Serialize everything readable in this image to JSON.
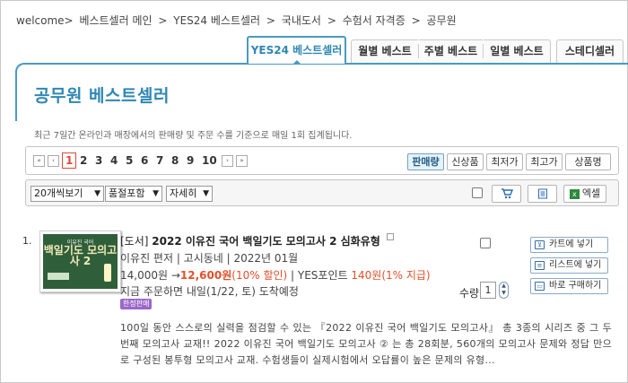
{
  "breadcrumb": [
    "welcome>",
    "베스트셀러 메인",
    ">",
    "YES24 베스트셀러",
    ">",
    "국내도서",
    ">",
    "수험서 자격증",
    ">",
    "공무원"
  ],
  "tabs": [
    {
      "label": "YES24 베스트셀러",
      "active": true
    },
    {
      "label": "월별 베스트",
      "active": false
    },
    {
      "label": "주별 베스트",
      "active": false
    },
    {
      "label": "일별 베스트",
      "active": false
    },
    {
      "label": "스테디셀러",
      "active": false
    }
  ],
  "page_title": "공무원 베스트셀러",
  "description": "최근 7일간 온라인과 매장에서의 판매량 및 주문 수를 기준으로 매일 1회 집계됩니다.",
  "pagination": {
    "first_icon": "double-left-arrow",
    "prev_icon": "left-arrow",
    "pages": [
      "1",
      "2",
      "3",
      "4",
      "5",
      "6",
      "7",
      "8",
      "9",
      "10"
    ],
    "current": "1",
    "next_icon": "right-arrow",
    "last_icon": "double-right-arrow"
  },
  "sort_options": [
    {
      "label": "판매량",
      "active": true
    },
    {
      "label": "신상품",
      "active": false
    },
    {
      "label": "최저가",
      "active": false
    },
    {
      "label": "최고가",
      "active": false
    },
    {
      "label": "상품명",
      "active": false
    }
  ],
  "view_controls": {
    "per_page": "20개씩보기",
    "stock": "품절포함",
    "detail": "자세히",
    "excel_label": "엑셀"
  },
  "product": {
    "rank": "1.",
    "category": "[도서]",
    "title": "2022 이유진 국어 백일기도 모의고사 2 심화유형",
    "author_line": "이유진 편저 | 고시동네 | 2022년 01월",
    "price_original": "14,000원",
    "price_arrow": "→",
    "price_sale": "12,600원",
    "discount": "(10% 할인)",
    "points_prefix": " | YES포인트 ",
    "points": "140원",
    "points_rate": "(1% 지급)",
    "delivery": "지금 주문하면 내일(1/22, 토) 도착예정",
    "badge": "한정판매",
    "cover_series": "이유진 국어",
    "cover_title": "백일기도 모의고사 2",
    "quantity_label": "수량",
    "quantity": "1",
    "buttons": [
      "카트에 넣기",
      "리스트에 넣기",
      "바로 구매하기"
    ],
    "summary": "100일 동안 스스로의 실력을 점검할 수 있는 『2022 이유진 국어 백일기도 모의고사』 총 3종의 시리즈 중 그 두 번째 모의고사 교재!! 2022 이유진 국어 백일기도 모의고사 ② 는 총 28회분, 560개의 모의고사 문제와 정답 만으로 구성된 봉투형 모의고사 교재. 수험생들이 실제시험에서 오답률이 높은 문제의 유형..."
  },
  "colors": {
    "accent": "#4a9bbe",
    "title": "#2f87b4",
    "sale": "#e2502c",
    "badge": "#9b68c9"
  }
}
